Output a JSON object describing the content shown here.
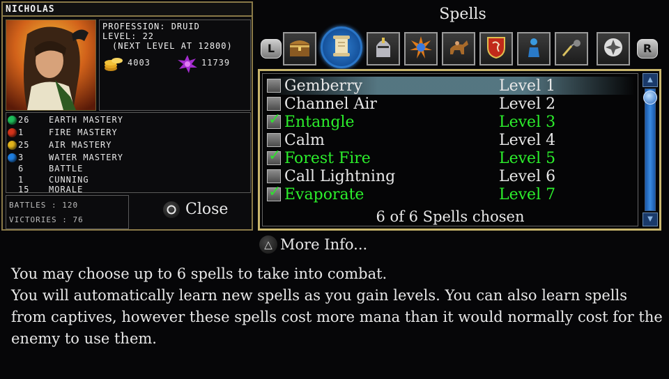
{
  "character": {
    "name": "Nicholas",
    "profession": "Profession: Druid",
    "level": "Level: 22",
    "next_level": "(Next level at 12800)",
    "gold": "4003",
    "mana": "11739"
  },
  "stats": [
    {
      "value": "26",
      "label": "Earth Mastery",
      "orb": "#1fbd5a"
    },
    {
      "value": "1",
      "label": "Fire Mastery",
      "orb": "#d2331a"
    },
    {
      "value": "25",
      "label": "Air Mastery",
      "orb": "#e2b41c"
    },
    {
      "value": "3",
      "label": "Water Mastery",
      "orb": "#1f7ee0"
    },
    {
      "value": "6",
      "label": "Battle",
      "orb": ""
    },
    {
      "value": "1",
      "label": "Cunning",
      "orb": ""
    },
    {
      "value": "15",
      "label": "Morale",
      "orb": ""
    }
  ],
  "record": {
    "battles": "Battles : 120",
    "victories": "Victories : 76"
  },
  "close_label": "Close",
  "spells_title": "Spells",
  "tabs": {
    "left_shoulder": "L",
    "right_shoulder": "R",
    "items": [
      "chest-icon",
      "scroll-icon",
      "helmet-icon",
      "sun-icon",
      "horse-icon",
      "dragon-shield-icon",
      "figure-icon",
      "flail-icon",
      "cross-icon"
    ]
  },
  "spells": [
    {
      "name": "Gemberry",
      "level": "Level 1",
      "chosen": false
    },
    {
      "name": "Channel Air",
      "level": "Level 2",
      "chosen": false
    },
    {
      "name": "Entangle",
      "level": "Level 3",
      "chosen": true
    },
    {
      "name": "Calm",
      "level": "Level 4",
      "chosen": false
    },
    {
      "name": "Forest Fire",
      "level": "Level 5",
      "chosen": true
    },
    {
      "name": "Call Lightning",
      "level": "Level 6",
      "chosen": false
    },
    {
      "name": "Evaporate",
      "level": "Level 7",
      "chosen": true
    }
  ],
  "chosen_count": "6 of 6 Spells chosen",
  "more_info_label": "More Info...",
  "description": [
    "You may choose up to 6 spells to take into combat.",
    "You will automatically learn new spells as you gain levels. You can also learn spells from captives, however these spells cost more mana than it would normally cost for the enemy to use them."
  ],
  "colors": {
    "accent_gold": "#c9b66d",
    "chosen_green": "#2cef2c",
    "active_tab_blue": "#2a76c8"
  }
}
